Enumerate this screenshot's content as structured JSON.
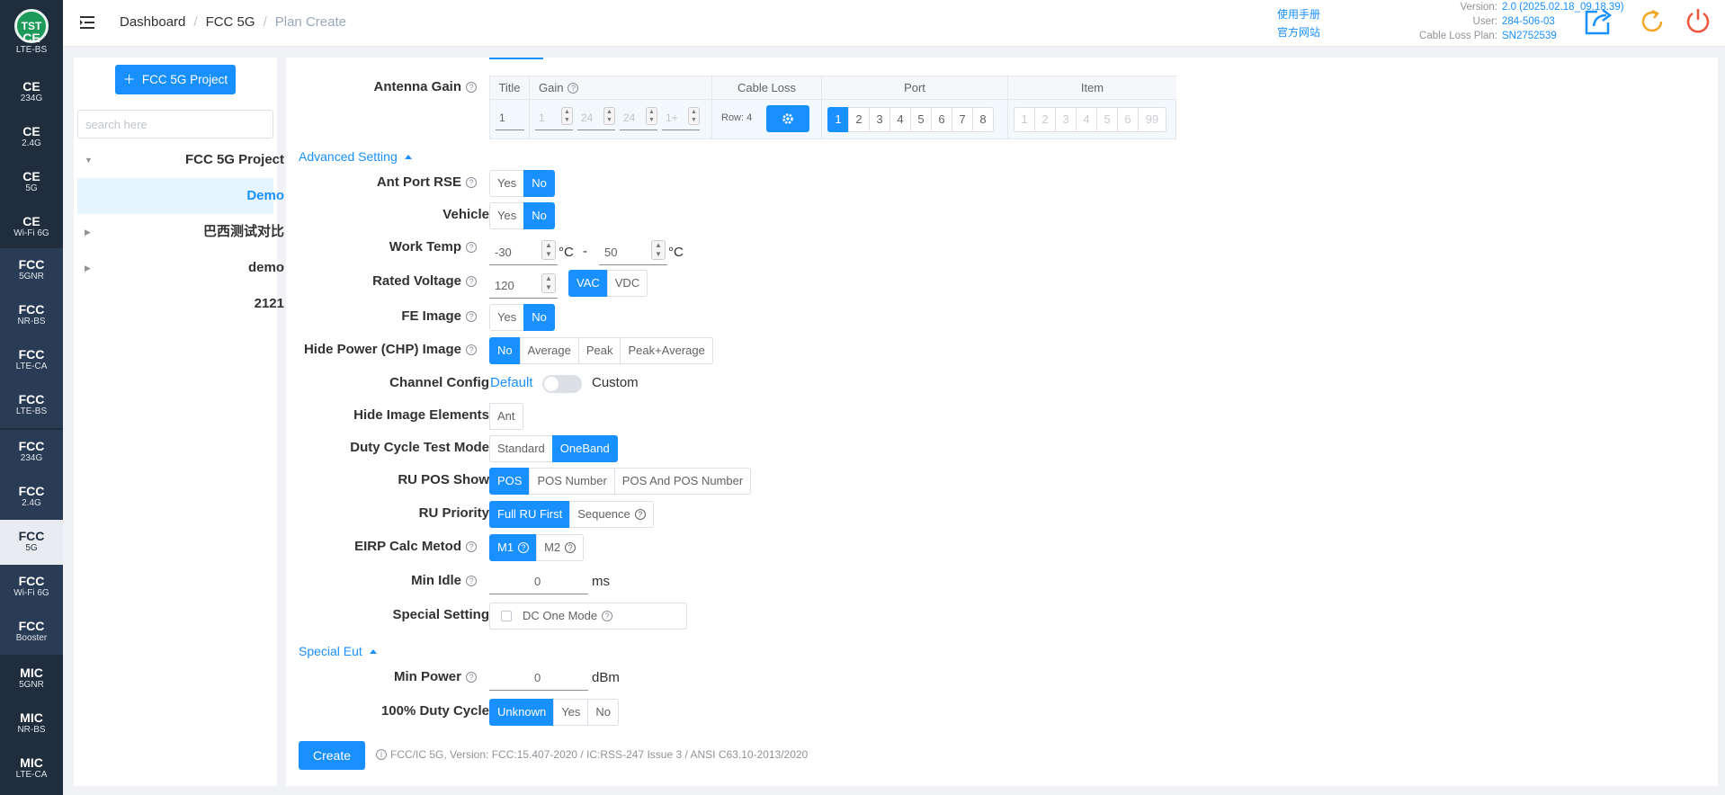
{
  "app": {
    "logo_text": "TST"
  },
  "left_nav": [
    {
      "top": "CE",
      "bottom": "LTE-BS",
      "kind": "ce"
    },
    {
      "top": "CE",
      "bottom": "234G",
      "kind": "ce"
    },
    {
      "top": "CE",
      "bottom": "2.4G",
      "kind": "ce"
    },
    {
      "top": "CE",
      "bottom": "5G",
      "kind": "ce"
    },
    {
      "top": "CE",
      "bottom": "Wi-Fi 6G",
      "kind": "ce"
    },
    {
      "top": "FCC",
      "bottom": "5GNR",
      "kind": "fcc"
    },
    {
      "top": "FCC",
      "bottom": "NR-BS",
      "kind": "fcc"
    },
    {
      "top": "FCC",
      "bottom": "LTE-CA",
      "kind": "fcc"
    },
    {
      "top": "FCC",
      "bottom": "LTE-BS",
      "kind": "fcc"
    },
    {
      "top": "FCC",
      "bottom": "234G",
      "kind": "fcc"
    },
    {
      "top": "FCC",
      "bottom": "2.4G",
      "kind": "fcc"
    },
    {
      "top": "FCC",
      "bottom": "5G",
      "kind": "active"
    },
    {
      "top": "FCC",
      "bottom": "Wi-Fi 6G",
      "kind": "fcc"
    },
    {
      "top": "FCC",
      "bottom": "Booster",
      "kind": "fcc"
    },
    {
      "top": "MIC",
      "bottom": "5GNR",
      "kind": "ce"
    },
    {
      "top": "MIC",
      "bottom": "NR-BS",
      "kind": "ce"
    },
    {
      "top": "MIC",
      "bottom": "LTE-CA",
      "kind": "ce"
    }
  ],
  "breadcrumb": {
    "home": "Dashboard",
    "section": "FCC 5G",
    "current": "Plan Create",
    "sep": "/"
  },
  "header": {
    "manual_link": "使用手册",
    "website_link": "官方网站",
    "version_label": "Version:",
    "version_value": "2.0 (2025.02.18_09.18.39)",
    "user_label": "User:",
    "user_value": "284-506-03",
    "cable_label": "Cable Loss Plan:",
    "cable_value": "SN2752539"
  },
  "tree": {
    "add_button": "FCC 5G Project",
    "search_placeholder": "search here",
    "nodes": {
      "project": "FCC 5G Project",
      "demo_selected": "Demo",
      "brazil": "巴西测试对比",
      "demo": "demo",
      "n2121": "2121"
    }
  },
  "form": {
    "antenna_gain": {
      "label": "Antenna Gain",
      "col_title": "Title",
      "col_gain": "Gain",
      "col_cable": "Cable Loss",
      "col_port": "Port",
      "col_item": "Item",
      "title_value": "1",
      "gain_values": [
        "1",
        "24",
        "24",
        "1+"
      ],
      "row_count": "Row: 4",
      "ports": [
        "1",
        "2",
        "3",
        "4",
        "5",
        "6",
        "7",
        "8"
      ],
      "items": [
        "1",
        "2",
        "3",
        "4",
        "5",
        "6",
        "99"
      ]
    },
    "advanced_setting": "Advanced Setting",
    "ant_port_rse": {
      "label": "Ant Port RSE",
      "yes": "Yes",
      "no": "No"
    },
    "vehicle": {
      "label": "Vehicle",
      "yes": "Yes",
      "no": "No"
    },
    "work_temp": {
      "label": "Work Temp",
      "min": "-30",
      "max": "50",
      "unit": "°C",
      "dash": "-"
    },
    "rated_voltage": {
      "label": "Rated Voltage",
      "value": "120",
      "vac": "VAC",
      "vdc": "VDC"
    },
    "fe_image": {
      "label": "FE Image",
      "yes": "Yes",
      "no": "No"
    },
    "hide_power": {
      "label": "Hide Power (CHP) Image",
      "opt_no": "No",
      "opt_avg": "Average",
      "opt_peak": "Peak",
      "opt_pa": "Peak+Average"
    },
    "channel_config": {
      "label": "Channel Config",
      "default": "Default",
      "custom": "Custom"
    },
    "hide_image_elements": {
      "label": "Hide Image Elements",
      "ant": "Ant"
    },
    "duty_cycle_mode": {
      "label": "Duty Cycle Test Mode",
      "standard": "Standard",
      "oneband": "OneBand"
    },
    "ru_pos_show": {
      "label": "RU POS Show",
      "pos": "POS",
      "pos_number": "POS Number",
      "both": "POS And POS Number"
    },
    "ru_priority": {
      "label": "RU Priority",
      "full": "Full RU First",
      "sequence": "Sequence"
    },
    "eirp_calc": {
      "label": "EIRP Calc Metod",
      "m1": "M1",
      "m2": "M2"
    },
    "min_idle": {
      "label": "Min Idle",
      "value": "0",
      "unit": "ms"
    },
    "special_setting": {
      "label": "Special Setting",
      "dc_one_mode": "DC One Mode"
    },
    "special_eut": "Special Eut",
    "min_power": {
      "label": "Min Power",
      "value": "0",
      "unit": "dBm"
    },
    "duty_cycle_100": {
      "label": "100% Duty Cycle",
      "unknown": "Unknown",
      "yes": "Yes",
      "no": "No"
    },
    "create_button": "Create",
    "footnote": "FCC/IC 5G, Version: FCC:15.407-2020 / IC:RSS-247 Issue 3 / ANSI C63.10-2013/2020"
  },
  "colors": {
    "primary": "#1890ff",
    "nav_bg": "#1f2d3d",
    "logo": "#1d9a59",
    "refresh": "#f5a623",
    "power": "#f0533c"
  }
}
